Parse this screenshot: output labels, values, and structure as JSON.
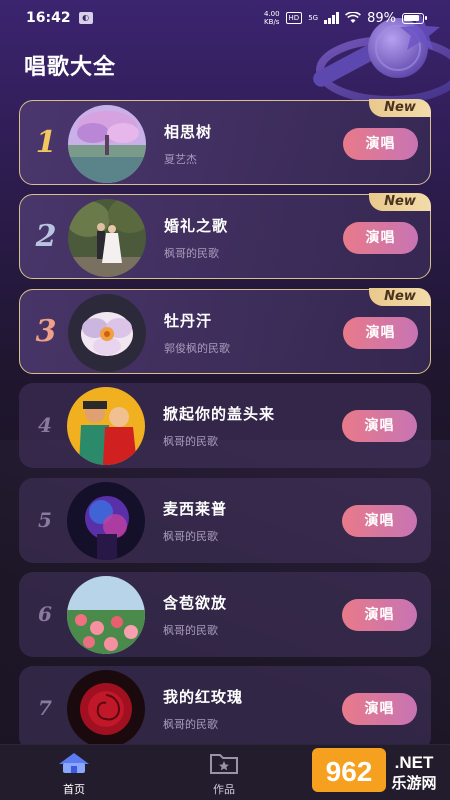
{
  "status_bar": {
    "time": "16:42",
    "net_speed_value": "4.00",
    "net_speed_unit": "KB/s",
    "hd_label": "HD",
    "signal_label": "5G",
    "battery_percent": "89%"
  },
  "header": {
    "title": "唱歌大全"
  },
  "songs": [
    {
      "rank": "1",
      "title": "相思树",
      "artist": "夏艺杰",
      "button": "演唱",
      "badge": "New",
      "highlight": true,
      "rank_color": "#f2c760"
    },
    {
      "rank": "2",
      "title": "婚礼之歌",
      "artist": "枫哥的民歌",
      "button": "演唱",
      "badge": "New",
      "highlight": true,
      "rank_color": "#b9c4e0"
    },
    {
      "rank": "3",
      "title": "牡丹汗",
      "artist": "郭俊枫的民歌",
      "button": "演唱",
      "badge": "New",
      "highlight": true,
      "rank_color": "#f0a088"
    },
    {
      "rank": "4",
      "title": "掀起你的盖头来",
      "artist": "枫哥的民歌",
      "button": "演唱",
      "badge": "",
      "highlight": false,
      "rank_color": "#8a7aa0"
    },
    {
      "rank": "5",
      "title": "麦西莱普",
      "artist": "枫哥的民歌",
      "button": "演唱",
      "badge": "",
      "highlight": false,
      "rank_color": "#8a7aa0"
    },
    {
      "rank": "6",
      "title": "含苞欲放",
      "artist": "枫哥的民歌",
      "button": "演唱",
      "badge": "",
      "highlight": false,
      "rank_color": "#8a7aa0"
    },
    {
      "rank": "7",
      "title": "我的红玫瑰",
      "artist": "枫哥的民歌",
      "button": "演唱",
      "badge": "",
      "highlight": false,
      "rank_color": "#8a7aa0"
    }
  ],
  "bottom_nav": {
    "home_label": "首页",
    "works_label": "作品"
  },
  "watermark": {
    "number": "962",
    "domain": ".NET",
    "site_name": "乐游网"
  },
  "colors": {
    "accent_button_start": "#e87a8a",
    "accent_button_end": "#c774b4",
    "new_badge": "#e9c98c"
  }
}
